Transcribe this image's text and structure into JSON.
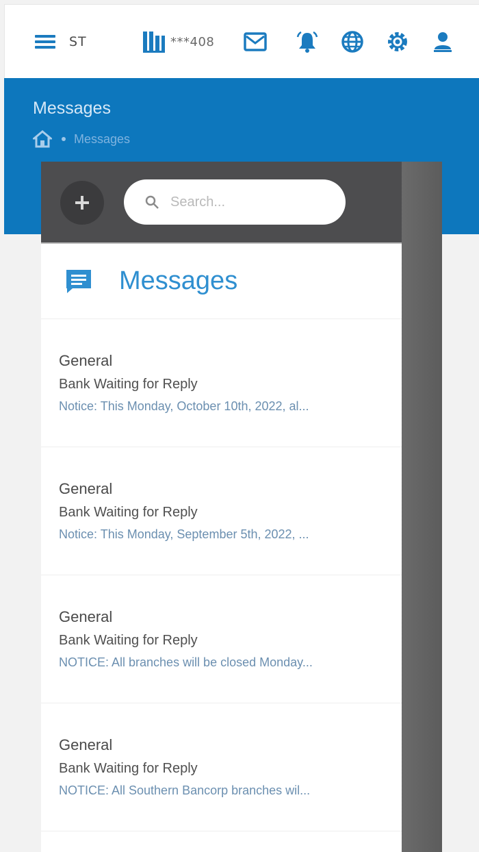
{
  "header": {
    "user_initials": "ST",
    "account_number": "***408",
    "icons": [
      "menu-icon",
      "bank-icon",
      "mail-icon",
      "bell-icon",
      "globe-icon",
      "gear-icon",
      "user-icon"
    ],
    "accent_color": "#1b7bbf"
  },
  "banner": {
    "title": "Messages",
    "breadcrumb": {
      "home_icon": "home-icon",
      "current": "Messages"
    },
    "background_color": "#0d77bd"
  },
  "panel": {
    "search": {
      "placeholder": "Search..."
    },
    "add_icon": "plus-icon",
    "title": "Messages",
    "title_icon": "message-icon",
    "messages": [
      {
        "category": "General",
        "status": "Bank Waiting for Reply",
        "preview": "Notice: This Monday, October 10th, 2022, al..."
      },
      {
        "category": "General",
        "status": "Bank Waiting for Reply",
        "preview": "Notice: This Monday, September 5th, 2022, ..."
      },
      {
        "category": "General",
        "status": "Bank Waiting for Reply",
        "preview": "NOTICE: All branches will be closed Monday..."
      },
      {
        "category": "General",
        "status": "Bank Waiting for Reply",
        "preview": "NOTICE: All Southern Bancorp branches wil..."
      }
    ]
  }
}
